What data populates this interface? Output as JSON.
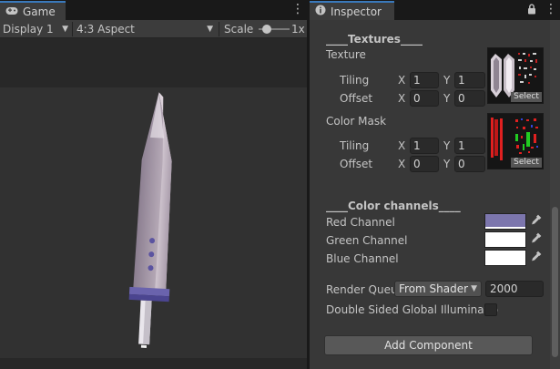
{
  "game": {
    "tab_label": "Game",
    "display_label": "Display 1",
    "aspect_label": "4:3 Aspect",
    "scale_label": "Scale",
    "scale_value": "1x",
    "scale_level": 0.15
  },
  "inspector": {
    "tab_label": "Inspector",
    "textures_header": "____Textures____",
    "texture_label": "Texture",
    "tiling_label": "Tiling",
    "offset_label": "Offset",
    "x_label": "X",
    "y_label": "Y",
    "texture_tiling_x": "1",
    "texture_tiling_y": "1",
    "texture_offset_x": "0",
    "texture_offset_y": "0",
    "select_label": "Select",
    "color_mask_label": "Color Mask",
    "mask_tiling_x": "1",
    "mask_tiling_y": "1",
    "mask_offset_x": "0",
    "mask_offset_y": "0",
    "color_channels_header": "____Color channels____",
    "red_label": "Red Channel",
    "green_label": "Green Channel",
    "blue_label": "Blue Channel",
    "red_color": "#7c76ad",
    "green_color": "#ffffff",
    "blue_color": "#ffffff",
    "render_queue_label": "Render Queu",
    "render_queue_option": "From Shader",
    "render_queue_value": "2000",
    "double_sided_label": "Double Sided Global Illuminatio",
    "add_component_label": "Add Component"
  }
}
